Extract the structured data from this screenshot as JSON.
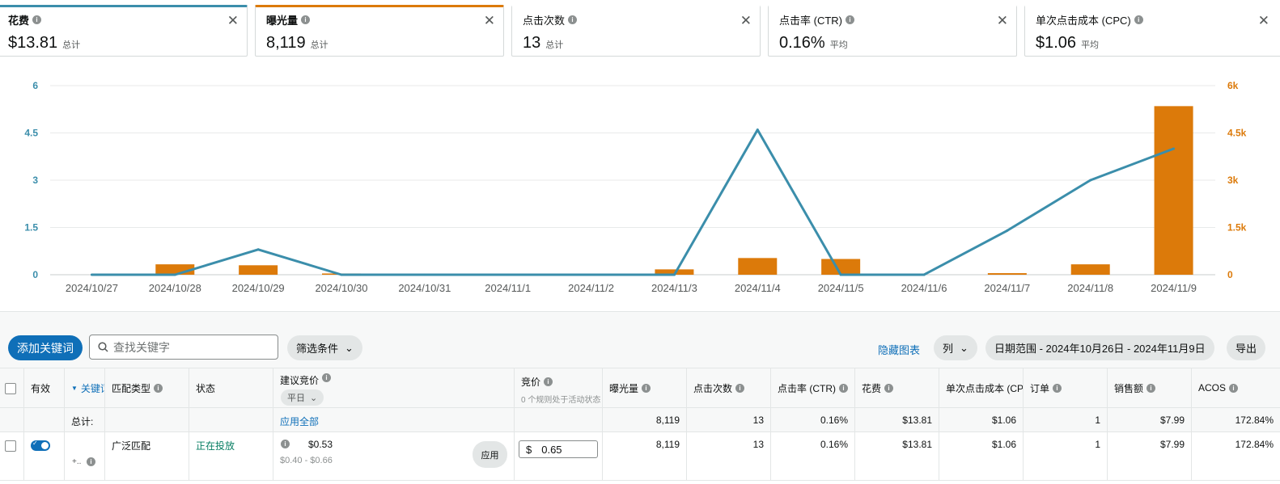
{
  "colors": {
    "blue": "#3b8eab",
    "orange": "#dc7a0a",
    "primary": "#0f6fb8"
  },
  "cards": [
    {
      "title": "花费",
      "value": "$13.81",
      "suffix": "总计",
      "accent": "#3b8eab",
      "selected": true
    },
    {
      "title": "曝光量",
      "value": "8,119",
      "suffix": "总计",
      "accent": "#dc7a0a",
      "selected": true
    },
    {
      "title": "点击次数",
      "value": "13",
      "suffix": "总计",
      "accent": "",
      "selected": false
    },
    {
      "title": "点击率 (CTR)",
      "value": "0.16%",
      "suffix": "平均",
      "accent": "",
      "selected": false
    },
    {
      "title": "单次点击成本 (CPC)",
      "value": "$1.06",
      "suffix": "平均",
      "accent": "",
      "selected": false
    }
  ],
  "chart_data": {
    "type": "bar+line",
    "categories": [
      "2024/10/27",
      "2024/10/28",
      "2024/10/29",
      "2024/10/30",
      "2024/10/31",
      "2024/11/1",
      "2024/11/2",
      "2024/11/3",
      "2024/11/4",
      "2024/11/5",
      "2024/11/6",
      "2024/11/7",
      "2024/11/8",
      "2024/11/9"
    ],
    "left_axis": {
      "ticks": [
        "0",
        "1.5",
        "3",
        "4.5",
        "6"
      ],
      "range": [
        0,
        6
      ]
    },
    "right_axis": {
      "ticks": [
        "0",
        "1.5k",
        "3k",
        "4.5k",
        "6k"
      ],
      "range": [
        0,
        6000
      ]
    },
    "series": [
      {
        "name": "花费",
        "kind": "line",
        "axis": "left",
        "color": "#3b8eab",
        "values": [
          0,
          0,
          0.8,
          0,
          0,
          0,
          0,
          0,
          4.6,
          0,
          0,
          1.4,
          3.0,
          4.0
        ]
      },
      {
        "name": "曝光量",
        "kind": "bar",
        "axis": "right",
        "color": "#dc7a0a",
        "values": [
          0,
          330,
          300,
          40,
          20,
          20,
          0,
          170,
          530,
          500,
          0,
          50,
          330,
          5350
        ]
      }
    ],
    "grid": true
  },
  "toolbar": {
    "add_keyword": "添加关键词",
    "search_placeholder": "查找关键字",
    "filter": "筛选条件",
    "hide_chart": "隐藏图表",
    "columns": "列",
    "date_range": "日期范围 - 2024年10月26日 - 2024年11月9日",
    "export": "导出"
  },
  "table": {
    "headers": {
      "active": "有效",
      "keyword": "关键词",
      "match": "匹配类型",
      "status": "状态",
      "suggested": "建议竞价",
      "weekday": "平日",
      "bid": "竞价",
      "bid_note": "0 个规则处于活动状态",
      "impressions": "曝光量",
      "clicks": "点击次数",
      "ctr": "点击率 (CTR)",
      "spend": "花费",
      "cpc": "单次点击成本 (CPC)",
      "orders": "订单",
      "sales": "销售额",
      "acos": "ACOS"
    },
    "total": {
      "label": "总计:",
      "apply_all": "应用全部",
      "impressions": "8,119",
      "clicks": "13",
      "ctr": "0.16%",
      "spend": "$13.81",
      "cpc": "$1.06",
      "orders": "1",
      "sales": "$7.99",
      "acos": "172.84%"
    },
    "rows": [
      {
        "keyword_extra": "+..",
        "match": "广泛匹配",
        "status": "正在投放",
        "suggested": "$0.53",
        "suggested_range": "$0.40 - $0.66",
        "apply": "应用",
        "currency": "$",
        "bid": "0.65",
        "impressions": "8,119",
        "clicks": "13",
        "ctr": "0.16%",
        "spend": "$13.81",
        "cpc": "$1.06",
        "orders": "1",
        "sales": "$7.99",
        "acos": "172.84%"
      }
    ]
  }
}
